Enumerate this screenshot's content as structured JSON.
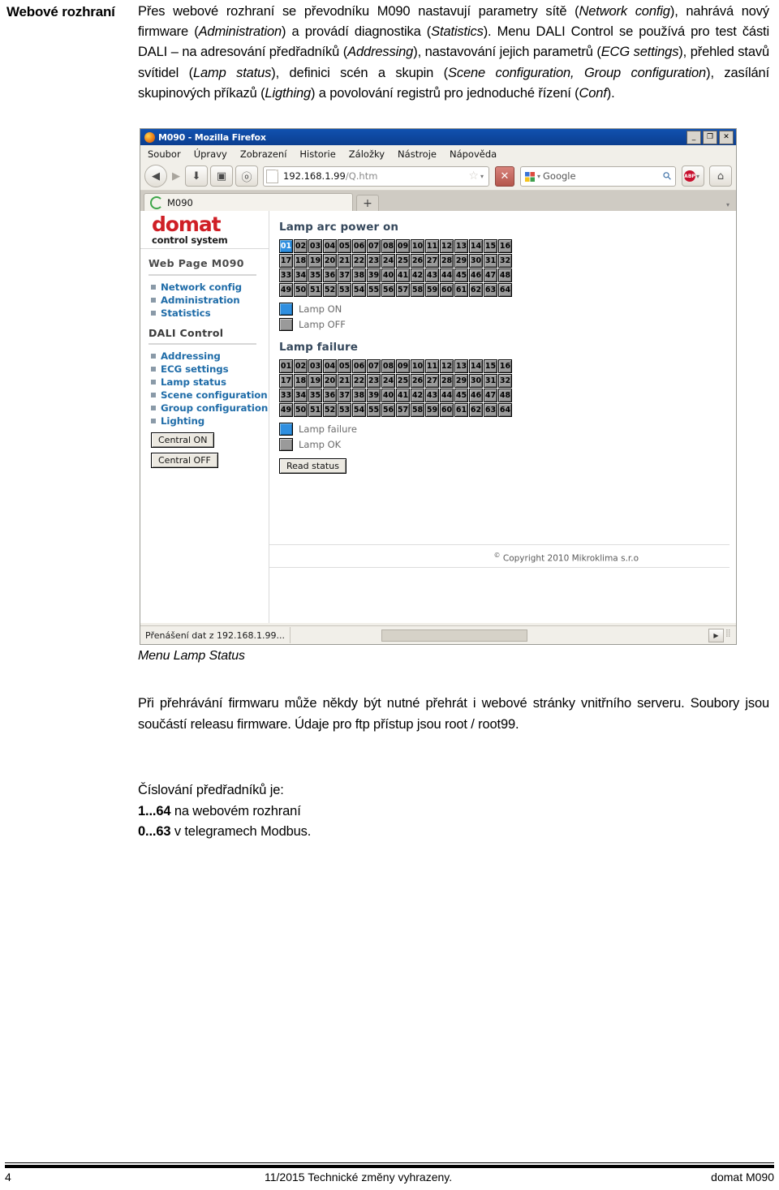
{
  "margin_heading": "Webové rozhraní",
  "body_paragraph": {
    "segments": [
      {
        "t": "Přes webové rozhraní se převodníku M090 nastavují parametry sítě (",
        "i": false
      },
      {
        "t": "Network config",
        "i": true
      },
      {
        "t": "), nahrává nový firmware (",
        "i": false
      },
      {
        "t": "Administration",
        "i": true
      },
      {
        "t": ") a provádí diagnostika (",
        "i": false
      },
      {
        "t": "Statistics",
        "i": true
      },
      {
        "t": "). Menu DALI Control se používá pro test části DALI – na adresování předřadníků (",
        "i": false
      },
      {
        "t": "Addressing",
        "i": true
      },
      {
        "t": "), nastavování jejich parametrů (",
        "i": false
      },
      {
        "t": "ECG settings",
        "i": true
      },
      {
        "t": "), přehled stavů svítidel (",
        "i": false
      },
      {
        "t": "Lamp status",
        "i": true
      },
      {
        "t": "), definici scén a skupin (",
        "i": false
      },
      {
        "t": "Scene configuration, Group configuration",
        "i": true
      },
      {
        "t": "), zasílání skupinových příkazů (",
        "i": false
      },
      {
        "t": "Ligthing",
        "i": true
      },
      {
        "t": ") a povolování registrů pro jednoduché řízení (",
        "i": false
      },
      {
        "t": "Conf",
        "i": true
      },
      {
        "t": ").",
        "i": false
      }
    ]
  },
  "caption": "Menu Lamp Status",
  "paragraph_2": "Při přehrávání firmwaru může někdy být nutné přehrát i webové stránky vnitřního serveru. Soubory jsou součástí releasu firmware. Údaje pro ftp přístup jsou root / root99.",
  "paragraph_3": {
    "intro": "Číslování předřadníků je:",
    "line1_bold": "1...64",
    "line1_rest": " na webovém rozhraní",
    "line2_bold": "0...63",
    "line2_rest": " v telegramech Modbus."
  },
  "footer": {
    "page_number": "4",
    "center": "11/2015 Technické změny vyhrazeny.",
    "right": "domat M090"
  },
  "browser": {
    "window_title": "M090 - Mozilla Firefox",
    "window_buttons": {
      "minimize": "_",
      "maximize": "❐",
      "close": "✕"
    },
    "menu": [
      {
        "pre": "S",
        "mid": "oubor",
        "post": ""
      },
      {
        "pre": "Ú",
        "mid": "pra",
        "post": "vy"
      },
      {
        "pre": "",
        "mid": "Z",
        "post": "obrazení"
      },
      {
        "pre": "",
        "mid": "H",
        "post": "istorie"
      },
      {
        "pre": "Zálo",
        "mid": "ž",
        "post": "ky"
      },
      {
        "pre": "",
        "mid": "N",
        "post": "ástroje"
      },
      {
        "pre": "Nápo",
        "mid": "v",
        "post": "ěda"
      }
    ],
    "menu_labels": [
      "Soubor",
      "Úpravy",
      "Zobrazení",
      "Historie",
      "Záložky",
      "Nástroje",
      "Nápověda"
    ],
    "toolbar": {
      "back": "◀",
      "forward": "▶",
      "home_glyph": "⌂",
      "download_glyph": "⬇",
      "bookmark_glyph": "▣",
      "history_glyph": "ⓞ",
      "stop": "✕",
      "star": "☆",
      "dropdown_caret": "▾",
      "magnifier": "⚲",
      "adblock_label": "ABP"
    },
    "url": {
      "host": "192.168.1.99",
      "path": "/Q.htm"
    },
    "search": {
      "engine": "Google",
      "placeholder": "Google"
    },
    "tab": {
      "label": "M090",
      "new_tab": "+",
      "list_caret": "▾"
    },
    "statusbar": {
      "text": "Přenášení dat z 192.168.1.99...",
      "scroll_right": "▶"
    }
  },
  "webpage": {
    "logo": {
      "main": "domat",
      "sub": "control system"
    },
    "nav_heading_1": "Web Page M090",
    "nav_group_1": [
      "Network config",
      "Administration",
      "Statistics"
    ],
    "nav_heading_2": "DALI Control",
    "nav_group_2": [
      "Addressing",
      "ECG settings",
      "Lamp status",
      "Scene configuration",
      "Group configuration",
      "Lighting"
    ],
    "buttons": {
      "central_on": "Central ON",
      "central_off": "Central OFF",
      "read_status": "Read status"
    },
    "section_1": {
      "title": "Lamp arc power on",
      "legend": [
        {
          "label": "Lamp ON",
          "state": "on",
          "color": "#2f8fe0"
        },
        {
          "label": "Lamp OFF",
          "state": "off",
          "color": "#9a9a9a"
        }
      ],
      "cells": [
        {
          "n": "01",
          "on": true
        },
        {
          "n": "02",
          "on": false
        },
        {
          "n": "03",
          "on": false
        },
        {
          "n": "04",
          "on": false
        },
        {
          "n": "05",
          "on": false
        },
        {
          "n": "06",
          "on": false
        },
        {
          "n": "07",
          "on": false
        },
        {
          "n": "08",
          "on": false
        },
        {
          "n": "09",
          "on": false
        },
        {
          "n": "10",
          "on": false
        },
        {
          "n": "11",
          "on": false
        },
        {
          "n": "12",
          "on": false
        },
        {
          "n": "13",
          "on": false
        },
        {
          "n": "14",
          "on": false
        },
        {
          "n": "15",
          "on": false
        },
        {
          "n": "16",
          "on": false
        },
        {
          "n": "17",
          "on": false
        },
        {
          "n": "18",
          "on": false
        },
        {
          "n": "19",
          "on": false
        },
        {
          "n": "20",
          "on": false
        },
        {
          "n": "21",
          "on": false
        },
        {
          "n": "22",
          "on": false
        },
        {
          "n": "23",
          "on": false
        },
        {
          "n": "24",
          "on": false
        },
        {
          "n": "25",
          "on": false
        },
        {
          "n": "26",
          "on": false
        },
        {
          "n": "27",
          "on": false
        },
        {
          "n": "28",
          "on": false
        },
        {
          "n": "29",
          "on": false
        },
        {
          "n": "30",
          "on": false
        },
        {
          "n": "31",
          "on": false
        },
        {
          "n": "32",
          "on": false
        },
        {
          "n": "33",
          "on": false
        },
        {
          "n": "34",
          "on": false
        },
        {
          "n": "35",
          "on": false
        },
        {
          "n": "36",
          "on": false
        },
        {
          "n": "37",
          "on": false
        },
        {
          "n": "38",
          "on": false
        },
        {
          "n": "39",
          "on": false
        },
        {
          "n": "40",
          "on": false
        },
        {
          "n": "41",
          "on": false
        },
        {
          "n": "42",
          "on": false
        },
        {
          "n": "43",
          "on": false
        },
        {
          "n": "44",
          "on": false
        },
        {
          "n": "45",
          "on": false
        },
        {
          "n": "46",
          "on": false
        },
        {
          "n": "47",
          "on": false
        },
        {
          "n": "48",
          "on": false
        },
        {
          "n": "49",
          "on": false
        },
        {
          "n": "50",
          "on": false
        },
        {
          "n": "51",
          "on": false
        },
        {
          "n": "52",
          "on": false
        },
        {
          "n": "53",
          "on": false
        },
        {
          "n": "54",
          "on": false
        },
        {
          "n": "55",
          "on": false
        },
        {
          "n": "56",
          "on": false
        },
        {
          "n": "57",
          "on": false
        },
        {
          "n": "58",
          "on": false
        },
        {
          "n": "59",
          "on": false
        },
        {
          "n": "60",
          "on": false
        },
        {
          "n": "61",
          "on": false
        },
        {
          "n": "62",
          "on": false
        },
        {
          "n": "63",
          "on": false
        },
        {
          "n": "64",
          "on": false
        }
      ]
    },
    "section_2": {
      "title": "Lamp failure",
      "legend": [
        {
          "label": "Lamp failure",
          "state": "on",
          "color": "#2f8fe0"
        },
        {
          "label": "Lamp OK",
          "state": "off",
          "color": "#9a9a9a"
        }
      ],
      "cells": [
        {
          "n": "01",
          "on": false
        },
        {
          "n": "02",
          "on": false
        },
        {
          "n": "03",
          "on": false
        },
        {
          "n": "04",
          "on": false
        },
        {
          "n": "05",
          "on": false
        },
        {
          "n": "06",
          "on": false
        },
        {
          "n": "07",
          "on": false
        },
        {
          "n": "08",
          "on": false
        },
        {
          "n": "09",
          "on": false
        },
        {
          "n": "10",
          "on": false
        },
        {
          "n": "11",
          "on": false
        },
        {
          "n": "12",
          "on": false
        },
        {
          "n": "13",
          "on": false
        },
        {
          "n": "14",
          "on": false
        },
        {
          "n": "15",
          "on": false
        },
        {
          "n": "16",
          "on": false
        },
        {
          "n": "17",
          "on": false
        },
        {
          "n": "18",
          "on": false
        },
        {
          "n": "19",
          "on": false
        },
        {
          "n": "20",
          "on": false
        },
        {
          "n": "21",
          "on": false
        },
        {
          "n": "22",
          "on": false
        },
        {
          "n": "23",
          "on": false
        },
        {
          "n": "24",
          "on": false
        },
        {
          "n": "25",
          "on": false
        },
        {
          "n": "26",
          "on": false
        },
        {
          "n": "27",
          "on": false
        },
        {
          "n": "28",
          "on": false
        },
        {
          "n": "29",
          "on": false
        },
        {
          "n": "30",
          "on": false
        },
        {
          "n": "31",
          "on": false
        },
        {
          "n": "32",
          "on": false
        },
        {
          "n": "33",
          "on": false
        },
        {
          "n": "34",
          "on": false
        },
        {
          "n": "35",
          "on": false
        },
        {
          "n": "36",
          "on": false
        },
        {
          "n": "37",
          "on": false
        },
        {
          "n": "38",
          "on": false
        },
        {
          "n": "39",
          "on": false
        },
        {
          "n": "40",
          "on": false
        },
        {
          "n": "41",
          "on": false
        },
        {
          "n": "42",
          "on": false
        },
        {
          "n": "43",
          "on": false
        },
        {
          "n": "44",
          "on": false
        },
        {
          "n": "45",
          "on": false
        },
        {
          "n": "46",
          "on": false
        },
        {
          "n": "47",
          "on": false
        },
        {
          "n": "48",
          "on": false
        },
        {
          "n": "49",
          "on": false
        },
        {
          "n": "50",
          "on": false
        },
        {
          "n": "51",
          "on": false
        },
        {
          "n": "52",
          "on": false
        },
        {
          "n": "53",
          "on": false
        },
        {
          "n": "54",
          "on": false
        },
        {
          "n": "55",
          "on": false
        },
        {
          "n": "56",
          "on": false
        },
        {
          "n": "57",
          "on": false
        },
        {
          "n": "58",
          "on": false
        },
        {
          "n": "59",
          "on": false
        },
        {
          "n": "60",
          "on": false
        },
        {
          "n": "61",
          "on": false
        },
        {
          "n": "62",
          "on": false
        },
        {
          "n": "63",
          "on": false
        },
        {
          "n": "64",
          "on": false
        }
      ]
    },
    "copyright": {
      "symbol": "©",
      "text": "Copyright 2010 Mikroklima s.r.o"
    }
  }
}
